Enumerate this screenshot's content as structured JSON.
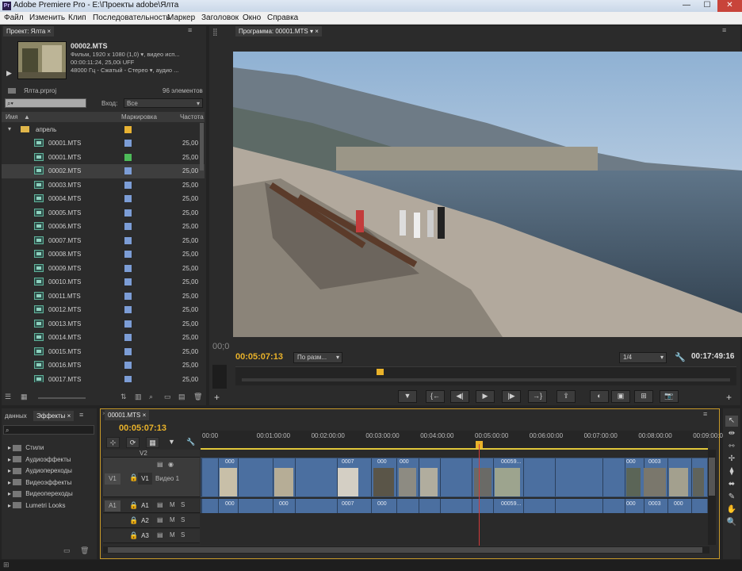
{
  "window": {
    "title": "Adobe Premiere Pro - E:\\Проекты adobe\\Ялта",
    "app_icon": "Pr",
    "controls": [
      "—",
      "☐",
      "✕"
    ]
  },
  "menu": [
    "Файл",
    "Изменить",
    "Клип",
    "Последовательность",
    "Маркер",
    "Заголовок",
    "Окно",
    "Справка"
  ],
  "project": {
    "tab": "Проект: Ялта",
    "clip_name": "00002.MTS",
    "clip_info": [
      "Фильм, 1920 x 1080 (1,0)",
      "00:00:11:24, 25,00i UFF",
      "48000 Гц - Сжатый - Стерео"
    ],
    "clip_info_extra": [
      ", видео исп...",
      "",
      ", аудио ..."
    ],
    "project_file": "Ялта.prproj",
    "item_count": "96 элементов",
    "search_placeholder": "",
    "input_label": "Вход:",
    "input_value": "Все",
    "columns": [
      "Имя",
      "Маркировка",
      "Частота"
    ],
    "folder": "апрель",
    "items": [
      {
        "name": "00001.MTS",
        "fps": "25,00",
        "color": "#7c9dd6"
      },
      {
        "name": "00001.MTS",
        "fps": "25,00",
        "color": "#4dbb59",
        "seq": true
      },
      {
        "name": "00002.MTS",
        "fps": "25,00",
        "color": "#7c9dd6"
      },
      {
        "name": "00003.MTS",
        "fps": "25,00",
        "color": "#7c9dd6"
      },
      {
        "name": "00004.MTS",
        "fps": "25,00",
        "color": "#7c9dd6"
      },
      {
        "name": "00005.MTS",
        "fps": "25,00",
        "color": "#7c9dd6"
      },
      {
        "name": "00006.MTS",
        "fps": "25,00",
        "color": "#7c9dd6"
      },
      {
        "name": "00007.MTS",
        "fps": "25,00",
        "color": "#7c9dd6"
      },
      {
        "name": "00008.MTS",
        "fps": "25,00",
        "color": "#7c9dd6"
      },
      {
        "name": "00009.MTS",
        "fps": "25,00",
        "color": "#7c9dd6"
      },
      {
        "name": "00010.MTS",
        "fps": "25,00",
        "color": "#7c9dd6"
      },
      {
        "name": "00011.MTS",
        "fps": "25,00",
        "color": "#7c9dd6"
      },
      {
        "name": "00012.MTS",
        "fps": "25,00",
        "color": "#7c9dd6"
      },
      {
        "name": "00013.MTS",
        "fps": "25,00",
        "color": "#7c9dd6"
      },
      {
        "name": "00014.MTS",
        "fps": "25,00",
        "color": "#7c9dd6"
      },
      {
        "name": "00015.MTS",
        "fps": "25,00",
        "color": "#7c9dd6"
      },
      {
        "name": "00016.MTS",
        "fps": "25,00",
        "color": "#7c9dd6"
      },
      {
        "name": "00017.MTS",
        "fps": "25,00",
        "color": "#7c9dd6"
      }
    ],
    "folder_color": "#e7b233"
  },
  "program": {
    "tab": "Программа: 00001.MTS",
    "timecode": "00:05:07:13",
    "fit": "По разм...",
    "quality": "1/4",
    "duration": "00:17:49:16",
    "left_tc": "00;0",
    "buttons": [
      "▼",
      "{←",
      "◀|",
      "▶",
      "|▶",
      "→}",
      "⇪",
      "◐",
      "▣",
      "⊞",
      "📷"
    ]
  },
  "effects": {
    "tabs": [
      "данных",
      "Эффекты"
    ],
    "items": [
      "Стили",
      "Аудиоэффекты",
      "Аудиопереходы",
      "Видеоэффекты",
      "Видеопереходы",
      "Lumetri Looks"
    ]
  },
  "timeline": {
    "tab": "00001.MTS",
    "timecode": "00:05:07:13",
    "ruler": [
      "00:00",
      "00:01:00:00",
      "00:02:00:00",
      "00:03:00:00",
      "00:04:00:00",
      "00:05:00:00",
      "00:06:00:00",
      "00:07:00:00",
      "00:08:00:00",
      "00:09:00:00"
    ],
    "tracks": {
      "v2": "V2",
      "v1_src": "V1",
      "v1": "V1",
      "v1_name": "Видео 1",
      "a1_src": "A1",
      "a1": "A1",
      "a2": "A2",
      "a3": "A3"
    },
    "clip_labels": [
      "000",
      "0007",
      "000",
      "000",
      "00059...",
      "000",
      "0003"
    ],
    "audio_labels": [
      "000",
      "000",
      "0007",
      "000",
      "00059...",
      "000",
      "0003",
      "000"
    ],
    "mute": "M",
    "solo": "S"
  },
  "tools": [
    "↖",
    "⇹",
    "⇿",
    "✢",
    "⧫",
    "⬌",
    "✎",
    "✋",
    "🔍"
  ]
}
